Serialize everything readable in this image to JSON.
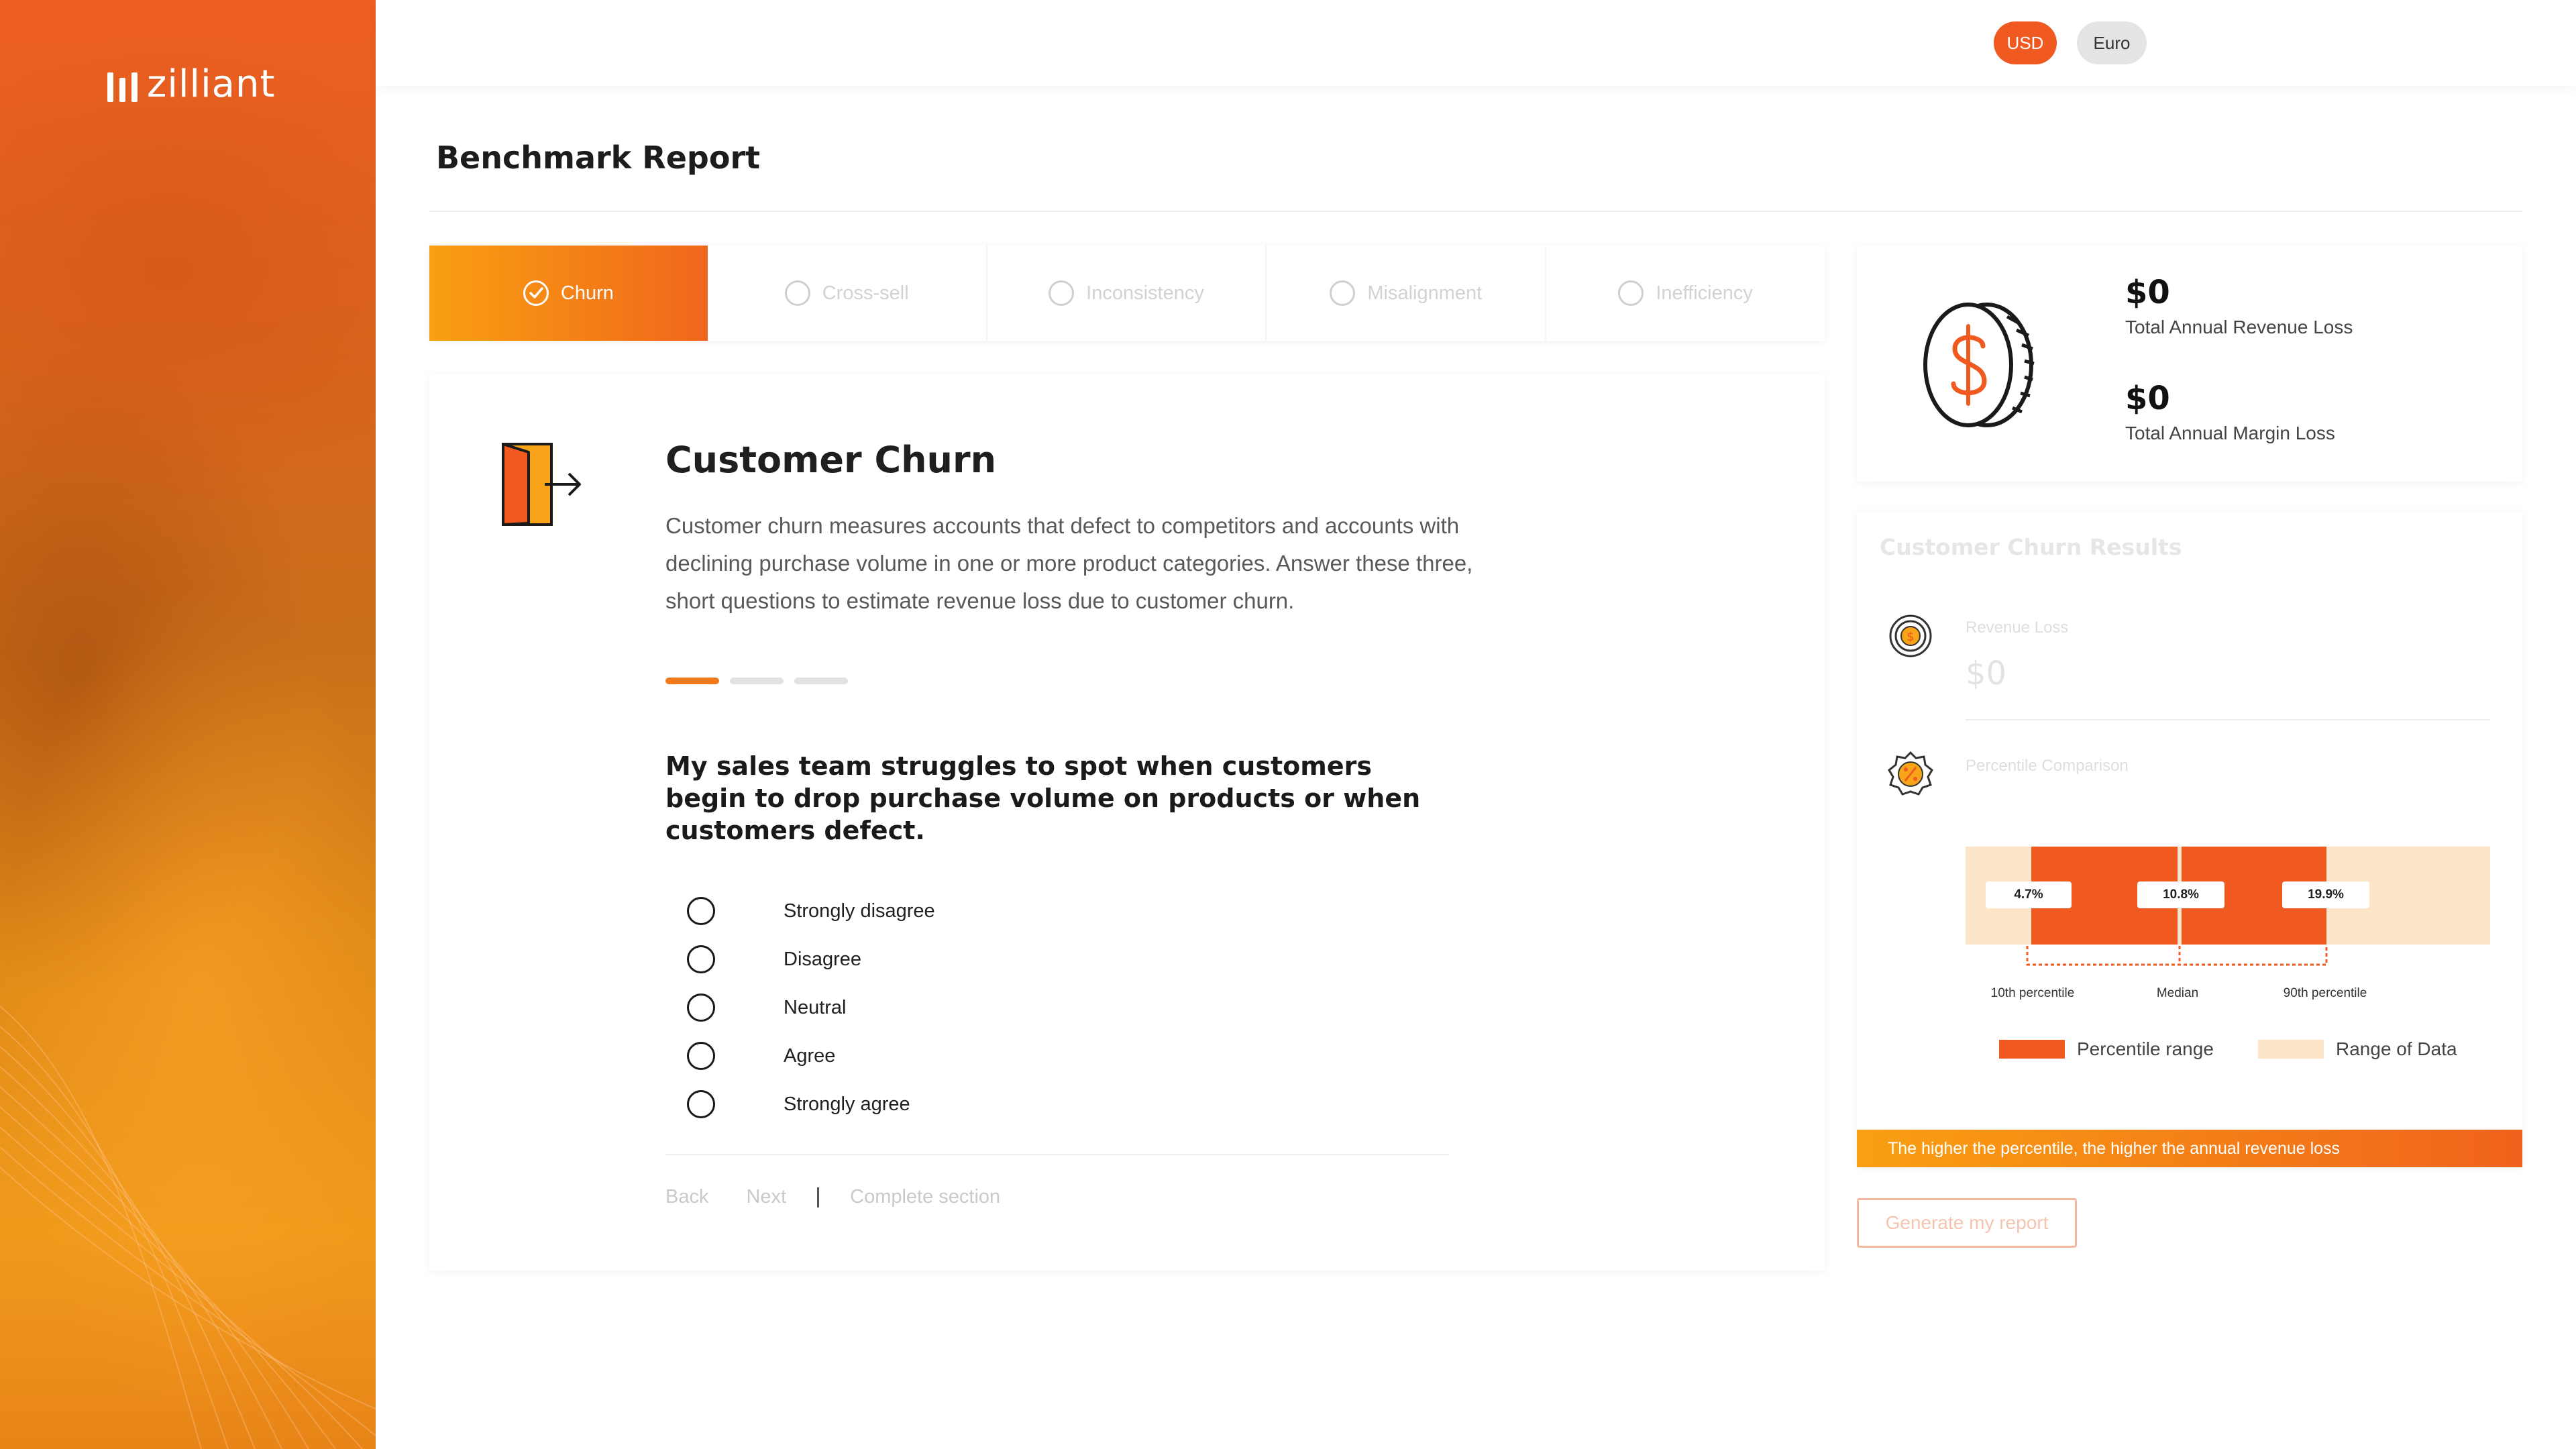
{
  "brand": {
    "name": "zilliant"
  },
  "currency": {
    "options": [
      "USD",
      "Euro"
    ],
    "selected": "USD"
  },
  "page": {
    "title": "Benchmark Report"
  },
  "tabs": [
    {
      "label": "Churn",
      "state": "complete"
    },
    {
      "label": "Cross-sell",
      "state": "pending"
    },
    {
      "label": "Inconsistency",
      "state": "pending"
    },
    {
      "label": "Misalignment",
      "state": "pending"
    },
    {
      "label": "Inefficiency",
      "state": "pending"
    }
  ],
  "section": {
    "icon": "exit-door-icon",
    "heading": "Customer Churn",
    "description": "Customer churn measures accounts that defect to competitors and accounts with declining purchase volume in one or more product categories. Answer these three, short questions to estimate revenue loss due to customer churn.",
    "question_step": 1,
    "question_total": 3,
    "question": "My sales team struggles to spot when customers begin to drop purchase volume on products or when customers defect.",
    "options": [
      "Strongly disagree",
      "Disagree",
      "Neutral",
      "Agree",
      "Strongly agree"
    ],
    "nav": {
      "back": "Back",
      "next": "Next",
      "complete": "Complete section"
    }
  },
  "summary": {
    "icon": "coin-dollar-icon",
    "revenue_value": "$0",
    "revenue_label": "Total Annual Revenue Loss",
    "margin_value": "$0",
    "margin_label": "Total Annual Margin Loss"
  },
  "results": {
    "title": "Customer Churn Results",
    "revenue_loss_label": "Revenue Loss",
    "revenue_loss_value": "$0",
    "percentile_label": "Percentile Comparison",
    "percentiles": [
      {
        "value": "4.7%",
        "label": "10th percentile"
      },
      {
        "value": "10.8%",
        "label": "Median"
      },
      {
        "value": "19.9%",
        "label": "90th percentile"
      }
    ],
    "legend": {
      "range": "Percentile range",
      "data": "Range of Data"
    },
    "colors": {
      "range": "#f0591f",
      "data": "#fde6c8"
    },
    "banner": "The higher the percentile, the higher the annual revenue loss",
    "generate_button": "Generate my report"
  }
}
